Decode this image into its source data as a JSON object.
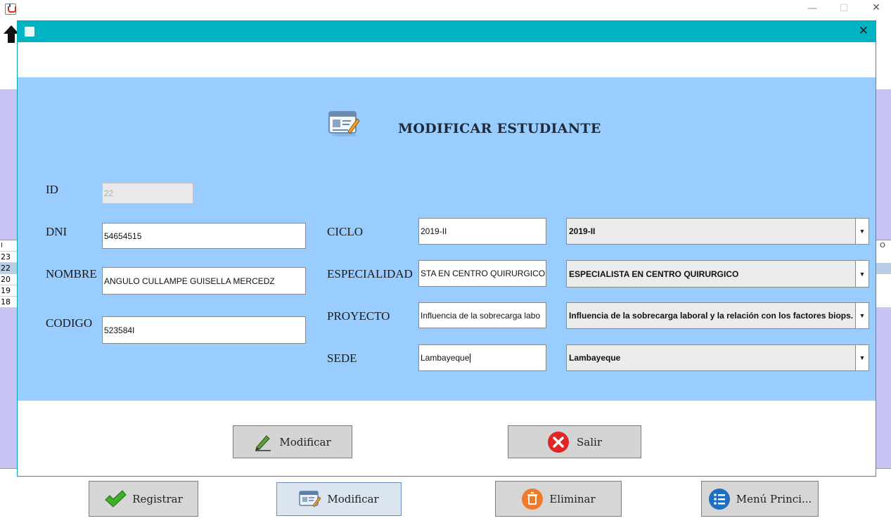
{
  "background_window": {
    "controls": {
      "minimize": "—",
      "maximize": "☐",
      "close": "✕"
    },
    "table_rows": [
      {
        "id": "23",
        "selected": false
      },
      {
        "id": "22",
        "selected": true
      },
      {
        "id": "20",
        "selected": false
      },
      {
        "id": "19",
        "selected": false
      },
      {
        "id": "18",
        "selected": false
      }
    ],
    "table_header_left": "I",
    "table_header_right": "O",
    "bottom_buttons": {
      "registrar": "Registrar",
      "modificar": "Modificar",
      "eliminar": "Eliminar",
      "menu": "Menú Princi..."
    }
  },
  "dialog": {
    "close": "✕",
    "heading": "MODIFICAR ESTUDIANTE",
    "labels": {
      "id": "ID",
      "dni": "DNI",
      "nombre": "NOMBRE",
      "codigo": "CODIGO",
      "ciclo": "CICLO",
      "especialidad": "ESPECIALIDAD",
      "proyecto": "PROYECTO",
      "sede": "SEDE"
    },
    "fields": {
      "id": "22",
      "dni": "54654515",
      "nombre": "ANGULO CULLAMPE GUISELLA MERCEDZ",
      "codigo": "523584I",
      "ciclo": "2019-II",
      "especialidad": "STA EN CENTRO QUIRURGICO",
      "proyecto": "Influencia de la sobrecarga labo",
      "sede": "Lambayeque"
    },
    "combos": {
      "ciclo": "2019-II",
      "especialidad": "ESPECIALISTA EN CENTRO QUIRURGICO",
      "proyecto": "Influencia de la sobrecarga laboral y la relación con los factores biops...",
      "sede": "Lambayeque"
    },
    "buttons": {
      "modificar": "Modificar",
      "salir": "Salir"
    }
  },
  "colors": {
    "dialog_title": "#00b4c3",
    "panel": "#99ccff",
    "background_accent": "#c8c5f4"
  }
}
